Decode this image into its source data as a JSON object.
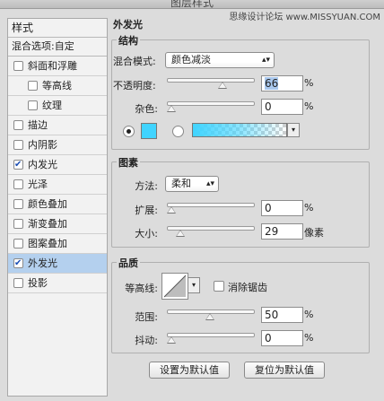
{
  "window": {
    "title": "图层样式",
    "watermark": "思缘设计论坛 www.MISSYUAN.COM"
  },
  "sidebar": {
    "header": "样式",
    "blend_options": "混合选项:自定",
    "items": [
      {
        "label": "斜面和浮雕",
        "checked": false,
        "indent": false
      },
      {
        "label": "等高线",
        "checked": false,
        "indent": true
      },
      {
        "label": "纹理",
        "checked": false,
        "indent": true
      },
      {
        "label": "描边",
        "checked": false,
        "indent": false
      },
      {
        "label": "内阴影",
        "checked": false,
        "indent": false
      },
      {
        "label": "内发光",
        "checked": true,
        "indent": false
      },
      {
        "label": "光泽",
        "checked": false,
        "indent": false
      },
      {
        "label": "颜色叠加",
        "checked": false,
        "indent": false
      },
      {
        "label": "渐变叠加",
        "checked": false,
        "indent": false
      },
      {
        "label": "图案叠加",
        "checked": false,
        "indent": false
      },
      {
        "label": "外发光",
        "checked": true,
        "indent": false,
        "selected": true
      },
      {
        "label": "投影",
        "checked": false,
        "indent": false
      }
    ]
  },
  "panel": {
    "title": "外发光",
    "structure": {
      "label": "结构",
      "blend_mode_label": "混合模式:",
      "blend_mode_value": "颜色减淡",
      "opacity_label": "不透明度:",
      "opacity_value": "66",
      "opacity_unit": "%",
      "opacity_level": 0.66,
      "noise_label": "杂色:",
      "noise_value": "0",
      "noise_unit": "%",
      "noise_level": 0,
      "color": "#40d4ff"
    },
    "elements": {
      "label": "图素",
      "technique_label": "方法:",
      "technique_value": "柔和",
      "spread_label": "扩展:",
      "spread_value": "0",
      "spread_unit": "%",
      "spread_level": 0,
      "size_label": "大小:",
      "size_value": "29",
      "size_unit": "像素",
      "size_level": 0.12
    },
    "quality": {
      "label": "品质",
      "contour_label": "等高线:",
      "antialias_label": "消除锯齿",
      "range_label": "范围:",
      "range_value": "50",
      "range_unit": "%",
      "range_level": 0.5,
      "jitter_label": "抖动:",
      "jitter_value": "0",
      "jitter_unit": "%",
      "jitter_level": 0
    },
    "buttons": {
      "set_default": "设置为默认值",
      "reset_default": "复位为默认值"
    }
  }
}
